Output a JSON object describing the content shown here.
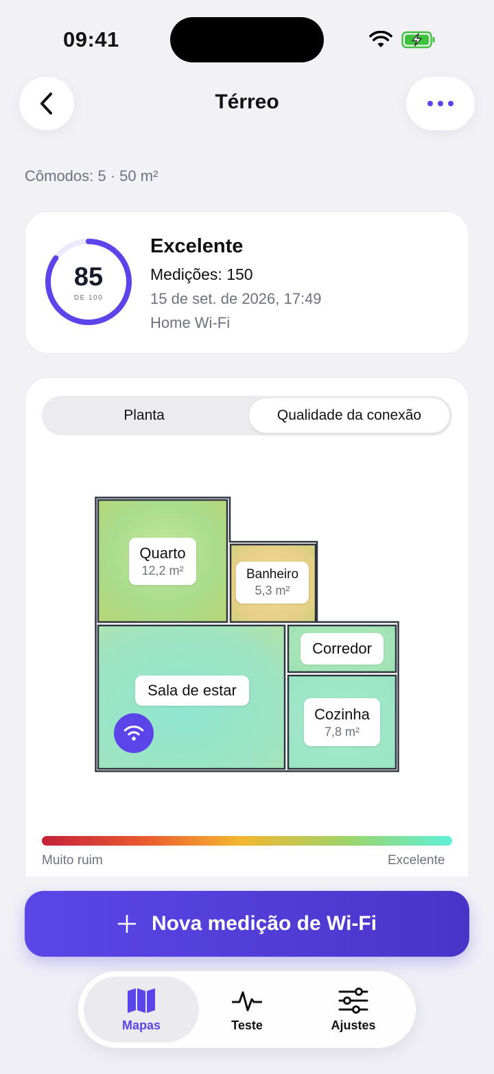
{
  "status_bar": {
    "time": "09:41"
  },
  "header": {
    "title": "Térreo"
  },
  "summary": "Cômodos: 5 · 50 m²",
  "score_card": {
    "score": "85",
    "score_fraction": 0.85,
    "score_of": "DE 100",
    "label": "Excelente",
    "measurements": "Medições: 150",
    "date": "15 de set. de 2026, 17:49",
    "network": "Home Wi-Fi",
    "accent_color": "#5b45e8"
  },
  "segmented": {
    "floor_plan": "Planta",
    "quality": "Qualidade da conexão",
    "selected": "quality"
  },
  "rooms": [
    {
      "name": "Quarto",
      "area": "12,2 m²"
    },
    {
      "name": "Banheiro",
      "area": "5,3 m²"
    },
    {
      "name": "Corredor",
      "area": ""
    },
    {
      "name": "Sala de estar",
      "area": ""
    },
    {
      "name": "Cozinha",
      "area": "7,8 m²"
    }
  ],
  "scale": {
    "min_label": "Muito ruim",
    "max_label": "Excelente"
  },
  "cta": {
    "label": "Nova medição de Wi-Fi"
  },
  "tabs": [
    {
      "label": "Mapas",
      "icon": "map-icon",
      "active": true
    },
    {
      "label": "Teste",
      "icon": "pulse-icon",
      "active": false
    },
    {
      "label": "Ajustes",
      "icon": "sliders-icon",
      "active": false
    }
  ]
}
